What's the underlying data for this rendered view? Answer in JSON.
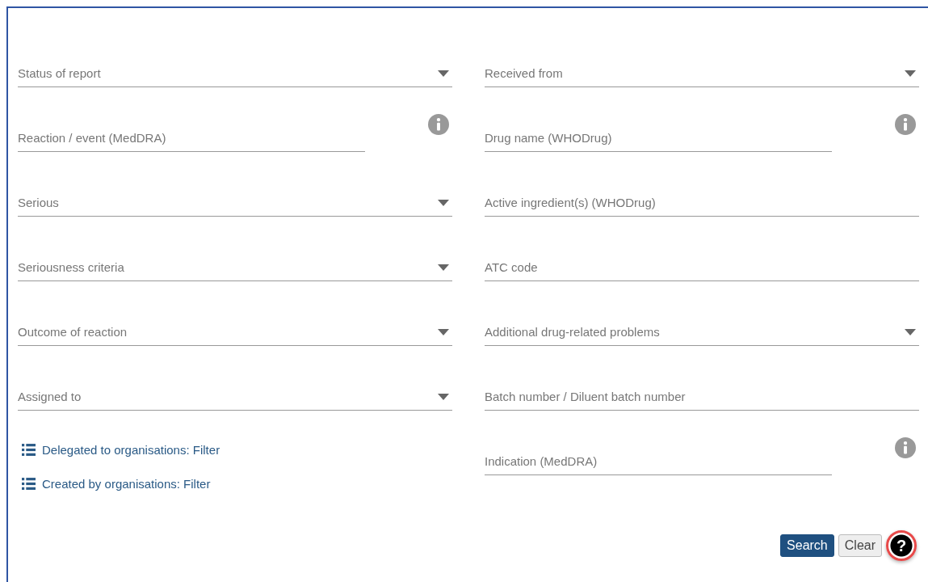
{
  "left_fields": [
    {
      "kind": "select",
      "label": "Status of report"
    },
    {
      "kind": "info",
      "label": "Reaction / event (MedDRA)"
    },
    {
      "kind": "select",
      "label": "Serious"
    },
    {
      "kind": "select",
      "label": "Seriousness criteria"
    },
    {
      "kind": "select",
      "label": "Outcome of reaction"
    },
    {
      "kind": "select",
      "label": "Assigned to"
    }
  ],
  "right_fields": [
    {
      "kind": "select",
      "label": "Received from"
    },
    {
      "kind": "info",
      "label": "Drug name (WHODrug)"
    },
    {
      "kind": "text",
      "label": "Active ingredient(s) (WHODrug)"
    },
    {
      "kind": "text",
      "label": "ATC code"
    },
    {
      "kind": "select",
      "label": "Additional drug-related problems"
    },
    {
      "kind": "text",
      "label": "Batch number / Diluent batch number"
    },
    {
      "kind": "info",
      "label": "Indication (MedDRA)"
    }
  ],
  "filter_links": [
    "Delegated to organisations: Filter",
    "Created by organisations: Filter"
  ],
  "buttons": {
    "search": "Search",
    "clear": "Clear",
    "help": "?"
  }
}
